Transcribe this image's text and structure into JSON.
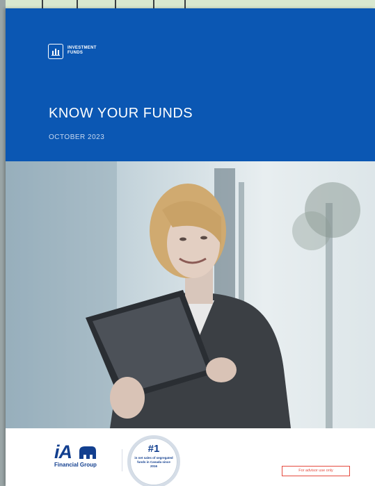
{
  "header": {
    "brand_line1": "INVESTMENT",
    "brand_line2": "FUNDS",
    "brand_icon": "bar-chart-icon",
    "title": "KNOW YOUR FUNDS",
    "date": "OCTOBER 2023"
  },
  "photo": {
    "subject": "woman-with-tablet"
  },
  "footer": {
    "logo_letters": "iA",
    "logo_subtitle": "Financial Group",
    "seal_rank": "#1",
    "seal_text": "in net sales of segregated funds in Canada since 2016",
    "advisor_note": "For advisor use only"
  },
  "colors": {
    "brand_blue": "#0b57b3",
    "logo_navy": "#123f8f",
    "advisor_red": "#e54a3e"
  }
}
